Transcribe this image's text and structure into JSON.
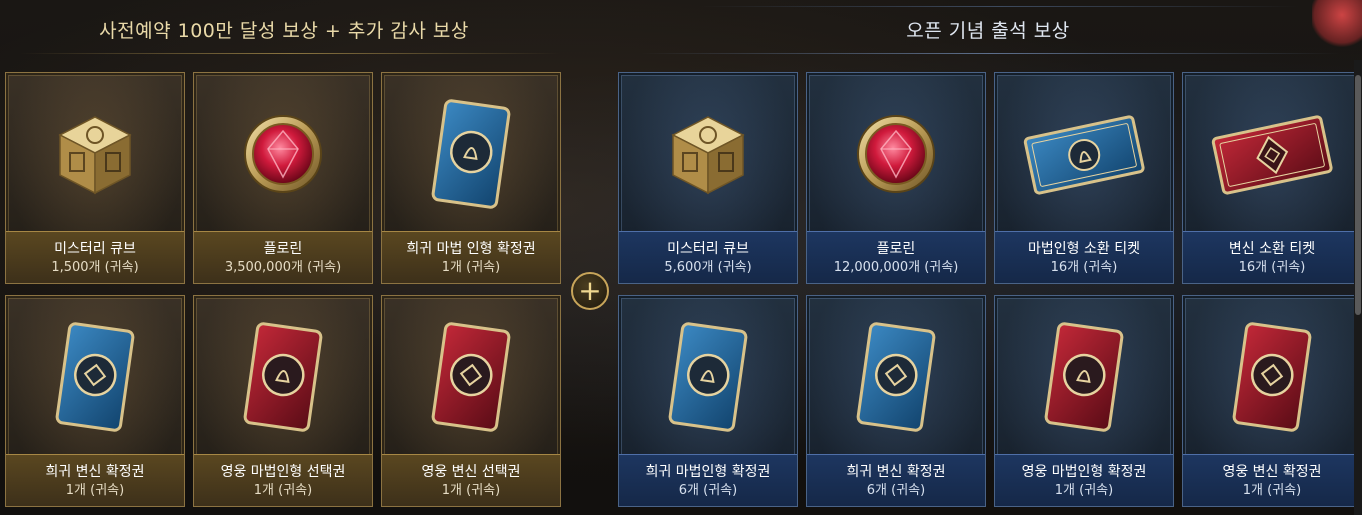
{
  "left_section": {
    "title": "사전예약 100만 달성 보상 + 추가 감사 보상",
    "cards": [
      {
        "name": "미스터리 큐브",
        "qty": "1,500개 (귀속)",
        "icon": "cube-icon"
      },
      {
        "name": "플로린",
        "qty": "3,500,000개 (귀속)",
        "icon": "florin-coin-icon"
      },
      {
        "name": "희귀 마법 인형 확정권",
        "qty": "1개 (귀속)",
        "icon": "blue-card-icon"
      },
      {
        "name": "희귀 변신 확정권",
        "qty": "1개 (귀속)",
        "icon": "blue-card-icon"
      },
      {
        "name": "영웅 마법인형 선택권",
        "qty": "1개 (귀속)",
        "icon": "red-card-icon"
      },
      {
        "name": "영웅 변신 선택권",
        "qty": "1개 (귀속)",
        "icon": "red-card-icon"
      }
    ]
  },
  "plus_button": {
    "label": "+"
  },
  "right_section": {
    "title": "오픈 기념 출석 보상",
    "cards": [
      {
        "name": "미스터리 큐브",
        "qty": "5,600개  (귀속)",
        "icon": "cube-icon"
      },
      {
        "name": "플로린",
        "qty": "12,000,000개 (귀속)",
        "icon": "florin-coin-icon"
      },
      {
        "name": "마법인형 소환 티켓",
        "qty": "16개 (귀속)",
        "icon": "blue-ticket-icon"
      },
      {
        "name": "변신 소환 티켓",
        "qty": "16개 (귀속)",
        "icon": "red-ticket-icon"
      },
      {
        "name": "희귀 마법인형 확정권",
        "qty": "6개 (귀속)",
        "icon": "blue-card-icon"
      },
      {
        "name": "희귀 변신 확정권",
        "qty": "6개 (귀속)",
        "icon": "blue-card-icon"
      },
      {
        "name": "영웅 마법인형 확정권",
        "qty": "1개 (귀속)",
        "icon": "red-card-icon"
      },
      {
        "name": "영웅 변신 확정권",
        "qty": "1개 (귀속)",
        "icon": "red-card-icon"
      }
    ]
  },
  "colors": {
    "gold_border": "#8c7342",
    "gold_label": "#4a3a1c",
    "blue_border": "#4a6387",
    "blue_label": "#18305a"
  }
}
